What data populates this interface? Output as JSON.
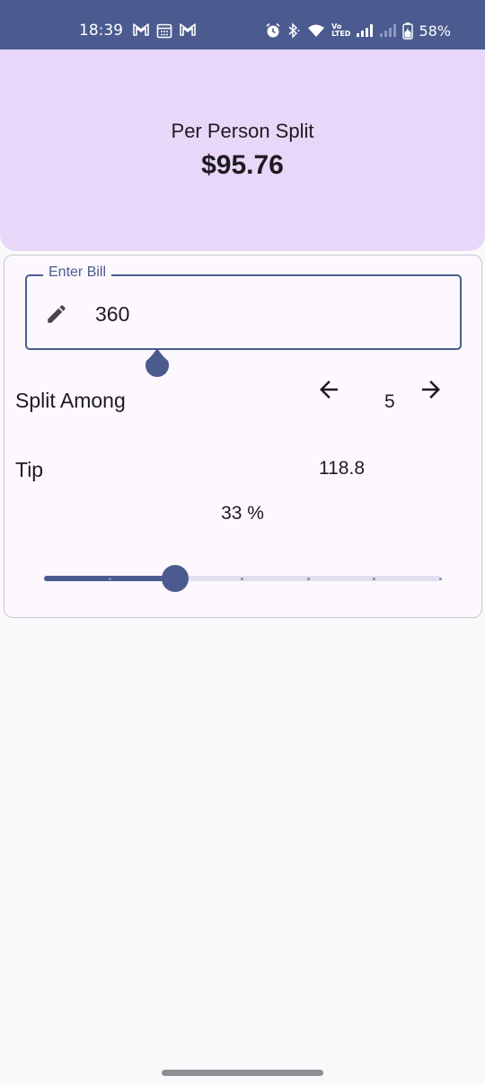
{
  "status_bar": {
    "time": "18:39",
    "battery": "58%",
    "network_label_top": "Vo",
    "network_label_bottom": "LTED",
    "left_icons": [
      "gmail-icon",
      "calendar-icon",
      "gmail-icon"
    ],
    "right_icons": [
      "alarm-icon",
      "bluetooth-icon",
      "wifi-icon",
      "signal-icon",
      "signal-icon",
      "battery-icon"
    ]
  },
  "header": {
    "label": "Per Person Split",
    "value": "$95.76",
    "background": "#e8d7f8"
  },
  "bill": {
    "label": "Enter Bill",
    "value": "360",
    "icon": "pencil-icon"
  },
  "split": {
    "label": "Split Among",
    "count": "5",
    "decrease_icon": "arrow-left-icon",
    "increase_icon": "arrow-right-icon"
  },
  "tip": {
    "label": "Tip",
    "value": "118.8",
    "percent_text": "33 %",
    "slider_fraction": 0.33,
    "slider_steps": 6
  },
  "colors": {
    "accent": "#4b5b8f",
    "status_bar": "#4b5b8f",
    "card": "#fcf8fd",
    "page": "#f9f9fb"
  }
}
